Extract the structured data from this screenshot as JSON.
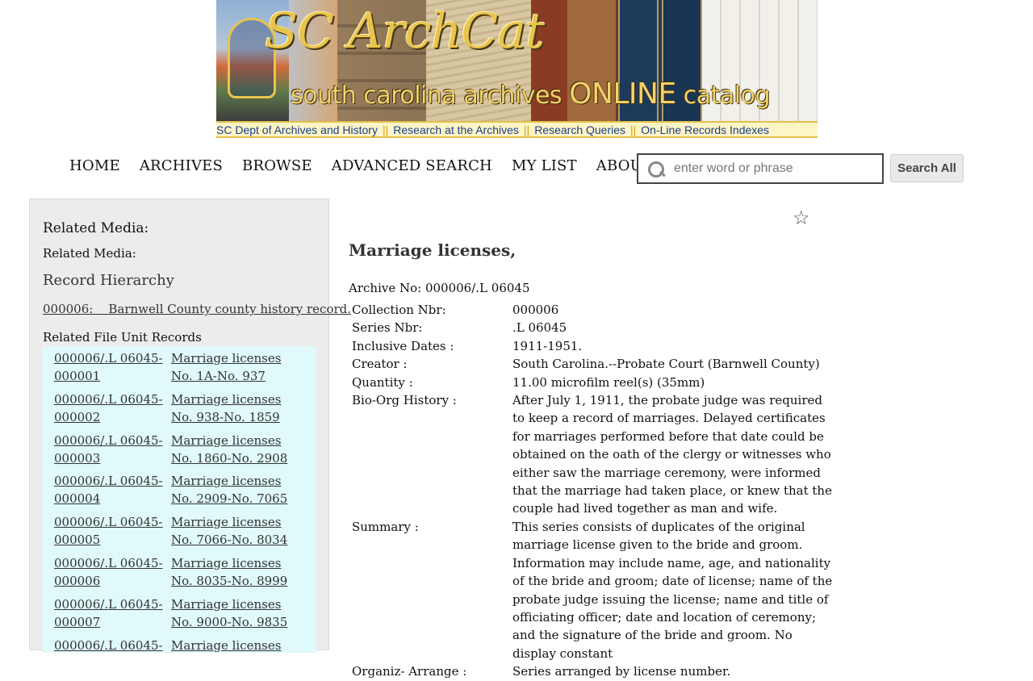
{
  "banner": {
    "logo": "SC ArchCat",
    "tagline_prefix": "south carolina archives ",
    "tagline_online": "ONLINE",
    "tagline_suffix": " catalog"
  },
  "top_links": [
    "SC Dept of Archives and History",
    "Research at the Archives",
    "Research Queries",
    "On-Line Records Indexes"
  ],
  "top_links_separator": "||",
  "nav": [
    "HOME",
    "ARCHIVES",
    "BROWSE",
    "ADVANCED SEARCH",
    "MY LIST",
    "ABOUT"
  ],
  "search": {
    "placeholder": "enter word or phrase",
    "button": "Search All"
  },
  "sidebar": {
    "related_media_heading": "Related Media:",
    "related_media_sub": "Related Media:",
    "record_hierarchy_heading": "Record Hierarchy",
    "hierarchy_link": "000006:    Barnwell County county history record.",
    "file_units_heading": "Related File Unit Records",
    "file_units": [
      {
        "id": "000006/.L 06045-000001",
        "desc": "Marriage licenses No. 1A-No. 937"
      },
      {
        "id": "000006/.L 06045-000002",
        "desc": "Marriage licenses No. 938-No. 1859"
      },
      {
        "id": "000006/.L 06045-000003",
        "desc": "Marriage licenses No. 1860-No. 2908"
      },
      {
        "id": "000006/.L 06045-000004",
        "desc": "Marriage licenses No. 2909-No. 7065"
      },
      {
        "id": "000006/.L 06045-000005",
        "desc": "Marriage licenses No. 7066-No. 8034"
      },
      {
        "id": "000006/.L 06045-000006",
        "desc": "Marriage licenses No. 8035-No. 8999"
      },
      {
        "id": "000006/.L 06045-000007",
        "desc": "Marriage licenses No. 9000-No. 9835"
      },
      {
        "id": "000006/.L 06045-",
        "desc": "Marriage licenses No."
      }
    ]
  },
  "record": {
    "title": "Marriage licenses,",
    "archive_no": "Archive No: 000006/.L 06045",
    "fields": [
      {
        "label": "Collection Nbr:",
        "value": "000006"
      },
      {
        "label": "Series Nbr:",
        "value": ".L 06045"
      },
      {
        "label": "Inclusive Dates :",
        "value": "1911-1951."
      },
      {
        "label": "Creator :",
        "value": "South Carolina.--Probate Court (Barnwell County)"
      },
      {
        "label": "Quantity :",
        "value": "11.00 microfilm reel(s) (35mm)"
      },
      {
        "label": "Bio-Org History :",
        "value": "After July 1, 1911, the probate judge was required to keep a record of marriages. Delayed certificates for marriages performed before that date could be obtained on the oath of the clergy or witnesses who either saw the marriage ceremony, were informed that the marriage had taken place, or knew that the couple had lived together as man and wife."
      },
      {
        "label": "Summary :",
        "value": "This series consists of duplicates of the original marriage license given to the bride and groom. Information may include name, age, and nationality of the bride and groom; date of license; name of the probate judge issuing the license; name and title of officiating officer; date and location of ceremony; and the signature of the bride and groom. No display constant"
      },
      {
        "label": "Organiz- Arrange :",
        "value": "Series arranged by license number."
      }
    ]
  }
}
